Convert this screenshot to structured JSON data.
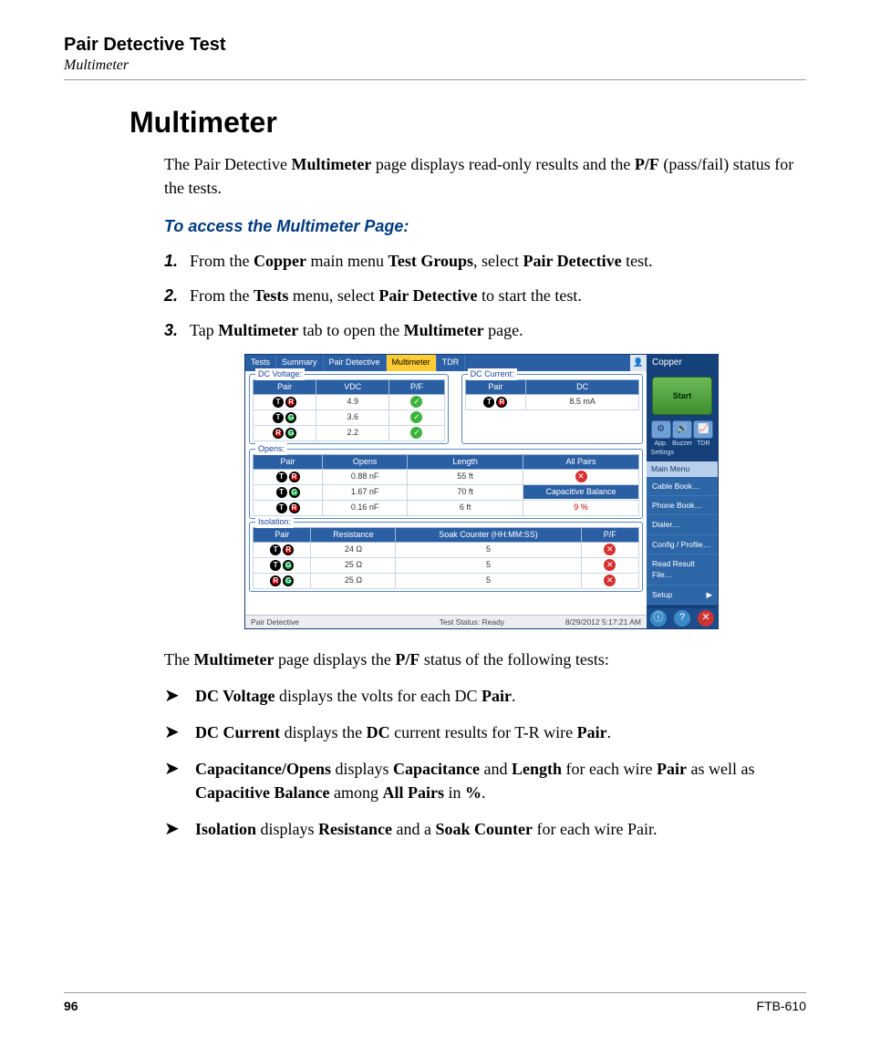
{
  "header": {
    "section": "Pair Detective Test",
    "topic": "Multimeter"
  },
  "h1": "Multimeter",
  "intro_html": "The Pair Detective <b>Multimeter</b> page displays read-only results and the <b>P/F</b> (pass/fail) status for the tests.",
  "howto_title": "To access the Multimeter Page:",
  "steps": [
    "From the <b>Copper</b> main menu <b>Test Groups</b>, select <b>Pair Detective</b> test.",
    "From the <b>Tests</b> menu, select <b>Pair Detective</b> to start the test.",
    "Tap <b>Multimeter</b> tab to open the <b>Multimeter</b> page."
  ],
  "after_shot": "The <b>Multimeter</b> page displays the <b>P/F</b> status of the following tests:",
  "bullets": [
    "<b>DC Voltage</b> displays the volts for each DC <b>Pair</b>.",
    "<b>DC Current</b> displays the <b>DC</b> current results for T-R wire <b>Pair</b>.",
    "<b>Capacitance/Opens</b> displays <b>Capacitance</b> and <b>Length</b> for each wire <b>Pair</b> as well as <b>Capacitive Balance</b> among <b>All Pairs</b> in <b>%</b>.",
    "<b>Isolation</b> displays <b>Resistance</b> and a <b>Soak Counter</b> for each wire Pair."
  ],
  "footer": {
    "page": "96",
    "model": "FTB-610"
  },
  "shot": {
    "tabs": [
      "Tests",
      "Summary",
      "Pair Detective",
      "Multimeter",
      "TDR"
    ],
    "active_tab": 3,
    "dcv": {
      "title": "DC Voltage:",
      "headers": [
        "Pair",
        "VDC",
        "P/F"
      ],
      "rows": [
        {
          "pair": [
            "T",
            "R"
          ],
          "vdc": "4.9",
          "pf": "pass"
        },
        {
          "pair": [
            "T",
            "G"
          ],
          "vdc": "3.6",
          "pf": "pass"
        },
        {
          "pair": [
            "R",
            "G"
          ],
          "vdc": "2.2",
          "pf": "pass"
        }
      ]
    },
    "dcc": {
      "title": "DC Current:",
      "headers": [
        "Pair",
        "DC"
      ],
      "rows": [
        {
          "pair": [
            "T",
            "R"
          ],
          "dc": "8.5 mA"
        }
      ]
    },
    "opens": {
      "title": "Opens:",
      "headers": [
        "Pair",
        "Opens",
        "Length",
        "All Pairs"
      ],
      "rows": [
        {
          "pair": [
            "T",
            "R"
          ],
          "opens": "0.88 nF",
          "len": "55 ft",
          "extra": "fail"
        },
        {
          "pair": [
            "T",
            "G"
          ],
          "opens": "1.67 nF",
          "len": "70 ft",
          "extra": "caphdr"
        },
        {
          "pair": [
            "T",
            "R"
          ],
          "opens": "0.16 nF",
          "len": "6 ft",
          "extra": "9 %"
        }
      ],
      "cap_balance_label": "Capacitive Balance"
    },
    "iso": {
      "title": "Isolation:",
      "headers": [
        "Pair",
        "Resistance",
        "Soak Counter (HH:MM:SS)",
        "P/F"
      ],
      "rows": [
        {
          "pair": [
            "T",
            "R"
          ],
          "r": "24 Ω",
          "soak": "5",
          "pf": "fail"
        },
        {
          "pair": [
            "T",
            "G"
          ],
          "r": "25 Ω",
          "soak": "5",
          "pf": "fail"
        },
        {
          "pair": [
            "R",
            "G"
          ],
          "r": "25 Ω",
          "soak": "5",
          "pf": "fail"
        }
      ]
    },
    "status": {
      "left": "Pair Detective",
      "center": "Test Status: Ready",
      "right": "8/29/2012 5:17:21 AM"
    },
    "side": {
      "header": "Copper",
      "start": "Start",
      "tools": [
        {
          "icon": "⚙",
          "label": "App. Settings"
        },
        {
          "icon": "🔊",
          "label": "Buzzer"
        },
        {
          "icon": "📈",
          "label": "TDR"
        }
      ],
      "menu_header": "Main Menu",
      "menu": [
        "Cable Book…",
        "Phone Book…",
        "Dialer…",
        "Config / Profile…",
        "Read Result File…",
        "Setup"
      ],
      "setup_arrow": "▶"
    }
  }
}
